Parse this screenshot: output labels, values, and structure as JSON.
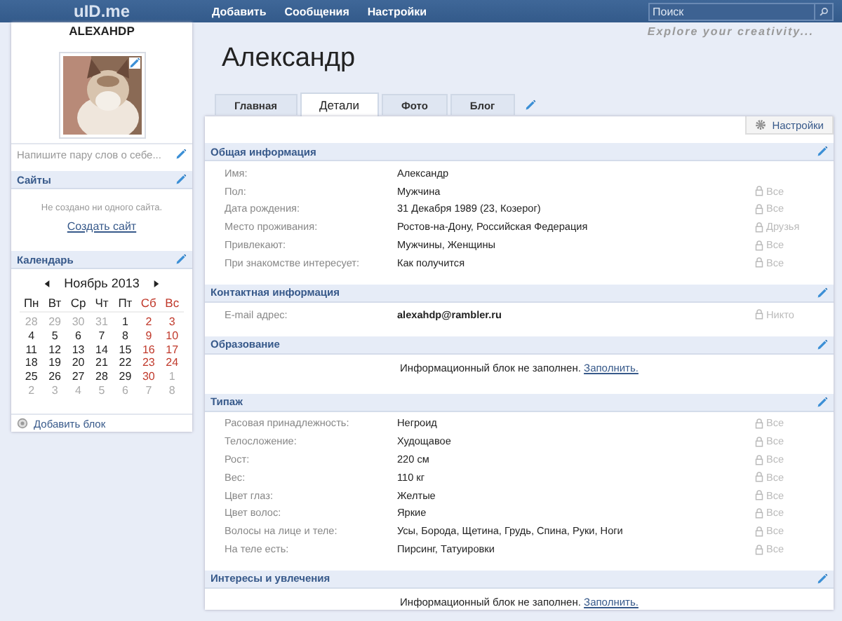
{
  "topbar": {
    "logo": "uID.me",
    "nav": [
      "Добавить",
      "Сообщения",
      "Настройки"
    ],
    "search": {
      "placeholder": "Поиск"
    }
  },
  "sidebar": {
    "username": "ALEXAHDP",
    "about": {
      "placeholder": "Напишите пару слов о себе..."
    },
    "sites": {
      "title": "Сайты",
      "text": "Не создано ни одного сайта.",
      "link": "Создать сайт"
    },
    "calendar": {
      "title": "Календарь",
      "month": "Ноябрь 2013",
      "weekdays": [
        "Пн",
        "Вт",
        "Ср",
        "Чт",
        "Пт",
        "Сб",
        "Вс"
      ],
      "weeks": [
        [
          {
            "d": "28",
            "muted": true
          },
          {
            "d": "29",
            "muted": true
          },
          {
            "d": "30",
            "muted": true
          },
          {
            "d": "31",
            "muted": true
          },
          {
            "d": "1",
            "muted": false
          },
          {
            "d": "2",
            "muted": false
          },
          {
            "d": "3",
            "muted": false
          }
        ],
        [
          {
            "d": "4",
            "muted": false
          },
          {
            "d": "5",
            "muted": false
          },
          {
            "d": "6",
            "muted": false
          },
          {
            "d": "7",
            "muted": false
          },
          {
            "d": "8",
            "muted": false
          },
          {
            "d": "9",
            "muted": false
          },
          {
            "d": "10",
            "muted": false
          }
        ],
        [
          {
            "d": "11",
            "muted": false
          },
          {
            "d": "12",
            "muted": false
          },
          {
            "d": "13",
            "muted": false
          },
          {
            "d": "14",
            "muted": false
          },
          {
            "d": "15",
            "muted": false
          },
          {
            "d": "16",
            "muted": false
          },
          {
            "d": "17",
            "muted": false
          }
        ],
        [
          {
            "d": "18",
            "muted": false
          },
          {
            "d": "19",
            "muted": false
          },
          {
            "d": "20",
            "muted": false
          },
          {
            "d": "21",
            "muted": false
          },
          {
            "d": "22",
            "muted": false
          },
          {
            "d": "23",
            "muted": false
          },
          {
            "d": "24",
            "muted": false
          }
        ],
        [
          {
            "d": "25",
            "muted": false
          },
          {
            "d": "26",
            "muted": false
          },
          {
            "d": "27",
            "muted": false
          },
          {
            "d": "28",
            "muted": false
          },
          {
            "d": "29",
            "muted": false
          },
          {
            "d": "30",
            "muted": false
          },
          {
            "d": "1",
            "muted": true
          }
        ],
        [
          {
            "d": "2",
            "muted": true
          },
          {
            "d": "3",
            "muted": true
          },
          {
            "d": "4",
            "muted": true
          },
          {
            "d": "5",
            "muted": true
          },
          {
            "d": "6",
            "muted": true
          },
          {
            "d": "7",
            "muted": true
          },
          {
            "d": "8",
            "muted": true
          }
        ]
      ]
    },
    "add_block": "Добавить блок"
  },
  "profile": {
    "name": "Александр",
    "tagline": "Explore your creativity...",
    "tabs": [
      {
        "label": "Главная",
        "selected": false
      },
      {
        "label": "Детали",
        "selected": true
      },
      {
        "label": "Фото",
        "selected": false
      },
      {
        "label": "Блог",
        "selected": false
      }
    ],
    "settings_button": "Настройки",
    "sections": [
      {
        "title": "Общая информация",
        "kind": "fields",
        "rows": [
          {
            "label": "Имя:",
            "value": "Александр",
            "bold": false
          },
          {
            "label": "Пол:",
            "value": "Мужчина",
            "bold": false,
            "privacy": "Все"
          },
          {
            "label": "Дата рождения:",
            "value": "31 Декабря 1989 (23, Козерог)",
            "bold": false,
            "privacy": "Все"
          },
          {
            "label": "Место проживания:",
            "value": "Ростов-на-Дону, Российская Федерация",
            "bold": false,
            "privacy": "Друзья"
          },
          {
            "label": "Привлекают:",
            "value": "Мужчины, Женщины",
            "bold": false,
            "privacy": "Все"
          },
          {
            "label": "При знакомстве интересует:",
            "value": "Как получится",
            "bold": false,
            "privacy": "Все"
          }
        ]
      },
      {
        "title": "Контактная информация",
        "kind": "fields",
        "rows": [
          {
            "label": "E-mail адрес:",
            "value": "alexahdp@rambler.ru",
            "bold": true,
            "privacy": "Никто"
          }
        ]
      },
      {
        "title": "Образование",
        "kind": "empty",
        "text": "Информационный блок не заполнен.",
        "link": "Заполнить."
      },
      {
        "title": "Типаж",
        "kind": "fields",
        "rows": [
          {
            "label": "Расовая принадлежность:",
            "value": "Негроид",
            "bold": false,
            "privacy": "Все"
          },
          {
            "label": "Телосложение:",
            "value": "Худощавое",
            "bold": false,
            "privacy": "Все"
          },
          {
            "label": "Рост:",
            "value": "220 см",
            "bold": false,
            "privacy": "Все"
          },
          {
            "label": "Вес:",
            "value": "110 кг",
            "bold": false,
            "privacy": "Все"
          },
          {
            "label": "Цвет глаз:",
            "value": "Желтые",
            "bold": false,
            "privacy": "Все"
          },
          {
            "label": "Цвет волос:",
            "value": "Яркие",
            "bold": false,
            "privacy": "Все"
          },
          {
            "label": "Волосы на лице и теле:",
            "value": "Усы, Борода, Щетина, Грудь, Спина, Руки, Ноги",
            "bold": false,
            "privacy": "Все"
          },
          {
            "label": "На теле есть:",
            "value": "Пирсинг, Татуировки",
            "bold": false,
            "privacy": "Все"
          }
        ]
      },
      {
        "title": "Интересы и увлечения",
        "kind": "empty",
        "text": "Информационный блок не заполнен.",
        "link": "Заполнить."
      }
    ]
  }
}
